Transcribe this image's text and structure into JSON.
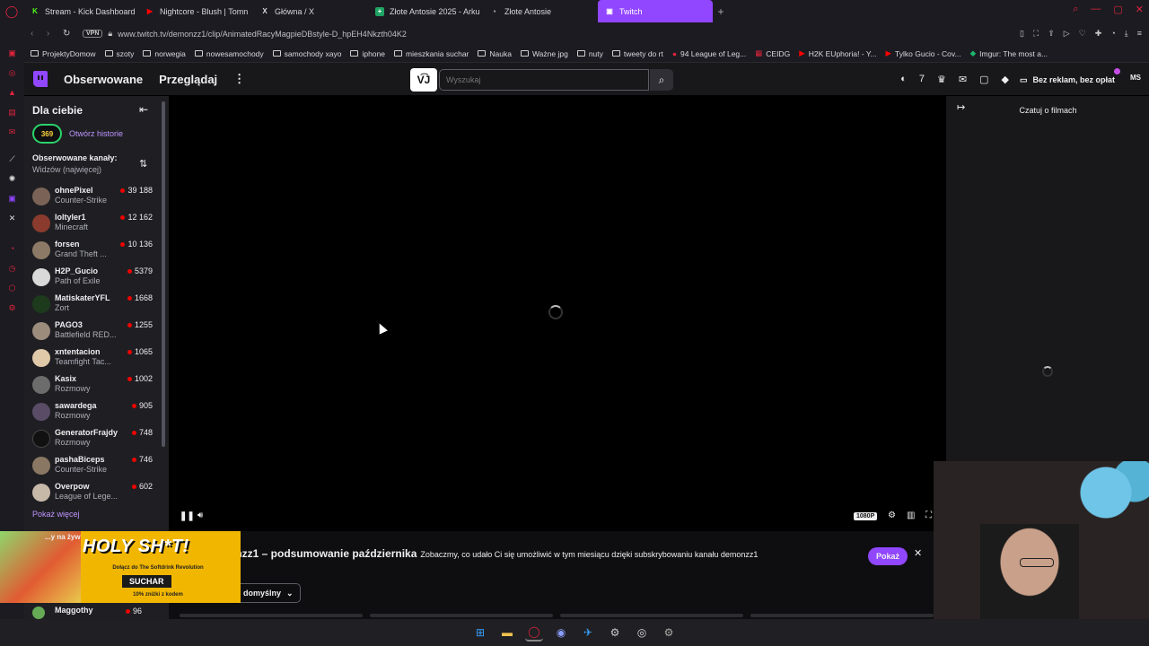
{
  "browser": {
    "tabs": [
      {
        "label": "Stream - Kick Dashboard",
        "color": "#53fc18",
        "glyph": "K"
      },
      {
        "label": "Nightcore - Blush | Tomn",
        "color": "#ff0000",
        "glyph": "▶"
      },
      {
        "label": "Główna / X",
        "color": "#ffffff",
        "glyph": "X"
      },
      {
        "label": "Złote Antosie 2025 - Arku",
        "color": "#1fa463",
        "glyph": "+"
      },
      {
        "label": "Złote Antosie",
        "color": "#9aa0a6",
        "glyph": "▪"
      },
      {
        "label": "Twitch",
        "color": "#ffffff",
        "glyph": "▣"
      }
    ],
    "vpn_label": "VPN",
    "url": "www.twitch.tv/demonzz1/clip/AnimatedRacyMagpieDBstyle-D_hpEH4Nkzth04K2",
    "bookmarks": [
      "ProjektyDomow",
      "szoty",
      "norwegia",
      "nowesamochody",
      "samochody xayo",
      "iphone",
      "mieszkania suchar",
      "Nauka",
      "Ważne jpg",
      "nuty",
      "tweety do rt",
      "94 League of Leg...",
      "CEIDG",
      "H2K EUphoria! - Y...",
      "Tylko Gucio - Cov...",
      "Imgur: The most a..."
    ]
  },
  "topnav": {
    "following": "Obserwowane",
    "browse": "Przeglądaj",
    "ext_label": "V͡J",
    "search_placeholder": "Wyszukaj",
    "ad_free": "Bez reklam, bez opłat",
    "user_initials": "MS"
  },
  "sidebar": {
    "title": "Dla ciebie",
    "history_badge": "369",
    "history_link": "Otwórz historie",
    "sort_title": "Obserwowane kanały:",
    "sort_sub": "Widzów (najwięcej)",
    "channels": [
      {
        "name": "ohnePixel",
        "game": "Counter-Strike",
        "viewers": "39 188"
      },
      {
        "name": "loltyler1",
        "game": "Minecraft",
        "viewers": "12 162"
      },
      {
        "name": "forsen",
        "game": "Grand Theft ...",
        "viewers": "10 136"
      },
      {
        "name": "H2P_Gucio",
        "game": "Path of Exile",
        "viewers": "5379"
      },
      {
        "name": "MatiskaterYFL",
        "game": "Zort",
        "viewers": "1668"
      },
      {
        "name": "PAGO3",
        "game": "Battlefield RED...",
        "viewers": "1255"
      },
      {
        "name": "xntentacion",
        "game": "Teamfight Tac...",
        "viewers": "1065"
      },
      {
        "name": "Kasix",
        "game": "Rozmowy",
        "viewers": "1002"
      },
      {
        "name": "sawardega",
        "game": "Rozmowy",
        "viewers": "905"
      },
      {
        "name": "GeneratorFrajdy",
        "game": "Rozmowy",
        "viewers": "748"
      },
      {
        "name": "pashaBiceps",
        "game": "Counter-Strike",
        "viewers": "746"
      },
      {
        "name": "Overpow",
        "game": "League of Lege...",
        "viewers": "602"
      }
    ],
    "show_more": "Pokaż więcej",
    "live_section_partial": "...y na żyw",
    "bottom_channel": {
      "name": "Maggothy",
      "viewers": "96"
    }
  },
  "player": {
    "quality": "1080P"
  },
  "chat": {
    "title": "Czatuj o filmach"
  },
  "banner": {
    "title": "onzz1 – podsumowanie października",
    "subtitle": "Zobaczmy, co udało Ci się umożliwić w tym miesiącu dzięki subskrybowaniu kanału demonzz1",
    "button": "Pokaż",
    "sort_label": "domyślny"
  },
  "ad": {
    "headline": "HOLY SH*T!",
    "line1": "Dołącz do The Softdrink Revolution",
    "brand": "SUCHAR",
    "promo": "10% zniżki z kodem"
  },
  "colors": {
    "twitch_purple": "#9146ff",
    "link_purple": "#bf94ff",
    "live_red": "#eb0400",
    "opera_red": "#e0243b"
  }
}
